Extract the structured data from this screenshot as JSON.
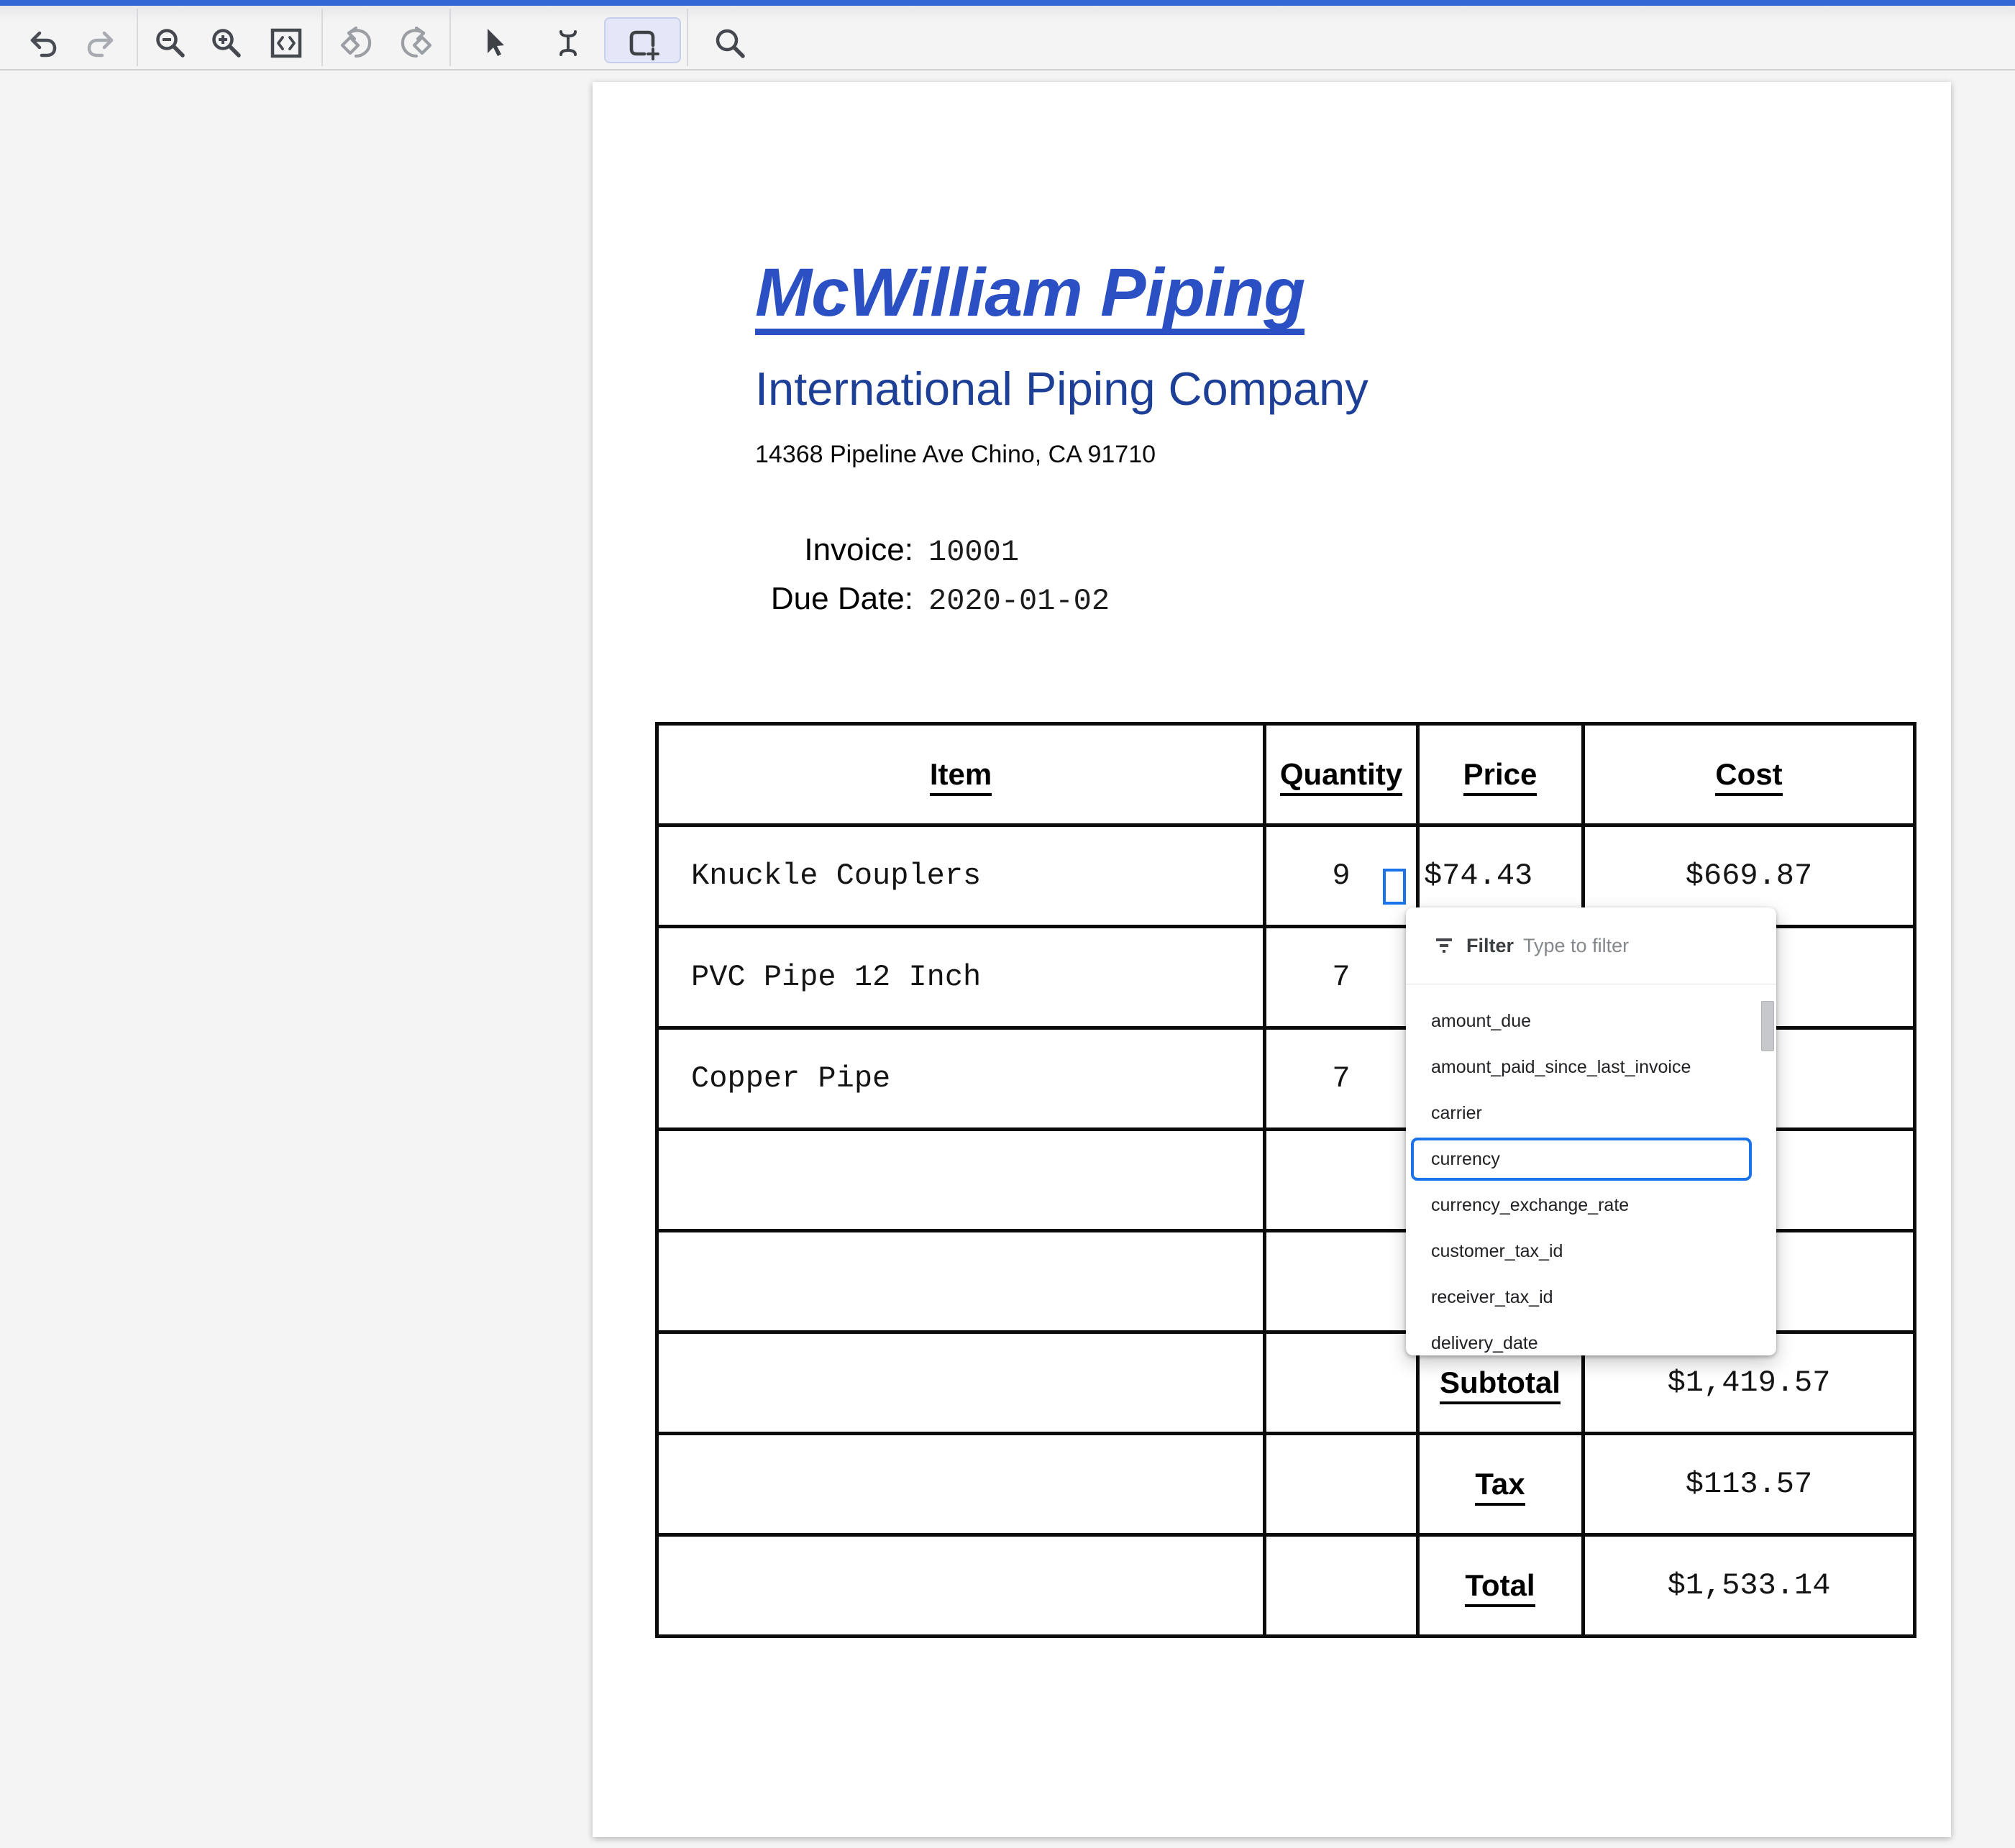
{
  "colors": {
    "topbar_blue": "#3367d6",
    "selection_blue": "#1a73e8",
    "title_blue": "#2b50c4",
    "subtitle_navy": "#1e3f96"
  },
  "toolbar": {
    "tools": [
      {
        "icon": "undo-icon"
      },
      {
        "icon": "redo-icon"
      },
      {
        "icon": "zoom-out-icon"
      },
      {
        "icon": "zoom-in-icon"
      },
      {
        "icon": "code-fit-icon"
      },
      {
        "icon": "rotate-left-icon"
      },
      {
        "icon": "rotate-right-icon"
      },
      {
        "icon": "cursor-icon"
      },
      {
        "icon": "text-select-icon"
      },
      {
        "icon": "region-select-icon",
        "active": true
      },
      {
        "icon": "search-icon"
      }
    ]
  },
  "document": {
    "company_title": "McWilliam Piping",
    "company_subtitle": "International Piping Company",
    "company_address": "14368 Pipeline Ave Chino, CA 91710",
    "invoice_label": "Invoice:",
    "invoice_number": "10001",
    "due_date_label": "Due Date:",
    "due_date": "2020-01-02",
    "table": {
      "headers": [
        "Item",
        "Quantity",
        "Price",
        "Cost"
      ],
      "rows": [
        {
          "item": "Knuckle Couplers",
          "quantity": "9",
          "price": "$74.43",
          "cost": "$669.87"
        },
        {
          "item": "PVC Pipe 12 Inch",
          "quantity": "7",
          "price": "$",
          "cost": ""
        },
        {
          "item": "Copper Pipe",
          "quantity": "7",
          "price": "$",
          "cost": ""
        },
        {
          "item": "",
          "quantity": "",
          "price": "",
          "cost": ""
        },
        {
          "item": "",
          "quantity": "",
          "price": "",
          "cost": ""
        }
      ],
      "summary": [
        {
          "label": "Subtotal",
          "value": "$1,419.57"
        },
        {
          "label": "Tax",
          "value": "$113.57"
        },
        {
          "label": "Total",
          "value": "$1,533.14"
        }
      ]
    }
  },
  "filter_dropdown": {
    "label": "Filter",
    "placeholder": "Type to filter",
    "items": [
      "amount_due",
      "amount_paid_since_last_invoice",
      "carrier",
      "currency",
      "currency_exchange_rate",
      "customer_tax_id",
      "receiver_tax_id",
      "delivery_date"
    ],
    "selected_item": "currency"
  }
}
